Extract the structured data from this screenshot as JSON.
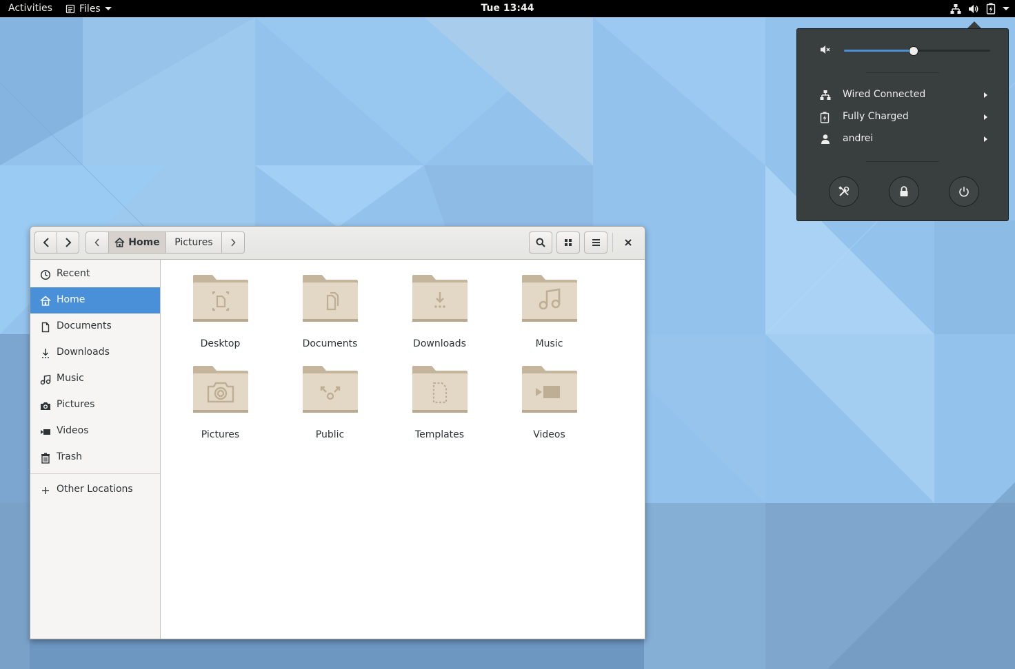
{
  "topbar": {
    "activities": "Activities",
    "app_menu": "Files",
    "clock": "Tue 13:44"
  },
  "system_menu": {
    "volume": 0.47,
    "items": [
      {
        "label": "Wired Connected",
        "icon": "network-wired-icon"
      },
      {
        "label": "Fully Charged",
        "icon": "battery-charged-icon"
      },
      {
        "label": "andrei",
        "icon": "user-icon"
      }
    ],
    "buttons": [
      "settings-icon",
      "lock-icon",
      "power-icon"
    ]
  },
  "files_window": {
    "path": [
      "Home",
      "Pictures"
    ],
    "sidebar": {
      "items": [
        {
          "label": "Recent",
          "icon": "clock-icon"
        },
        {
          "label": "Home",
          "icon": "home-icon",
          "active": true
        },
        {
          "label": "Documents",
          "icon": "document-icon"
        },
        {
          "label": "Downloads",
          "icon": "download-icon"
        },
        {
          "label": "Music",
          "icon": "music-icon"
        },
        {
          "label": "Pictures",
          "icon": "camera-icon"
        },
        {
          "label": "Videos",
          "icon": "video-icon"
        },
        {
          "label": "Trash",
          "icon": "trash-icon"
        }
      ],
      "other": {
        "label": "Other Locations",
        "icon": "plus-icon"
      }
    },
    "folders": [
      {
        "label": "Desktop",
        "icon": "desktop-folder-icon"
      },
      {
        "label": "Documents",
        "icon": "documents-folder-icon"
      },
      {
        "label": "Downloads",
        "icon": "downloads-folder-icon"
      },
      {
        "label": "Music",
        "icon": "music-folder-icon"
      },
      {
        "label": "Pictures",
        "icon": "pictures-folder-icon"
      },
      {
        "label": "Public",
        "icon": "public-folder-icon"
      },
      {
        "label": "Templates",
        "icon": "templates-folder-icon"
      },
      {
        "label": "Videos",
        "icon": "videos-folder-icon"
      }
    ]
  },
  "colors": {
    "accent": "#4a90d9",
    "desktop": "#8fbfea",
    "folder": "#d9cfbd"
  }
}
